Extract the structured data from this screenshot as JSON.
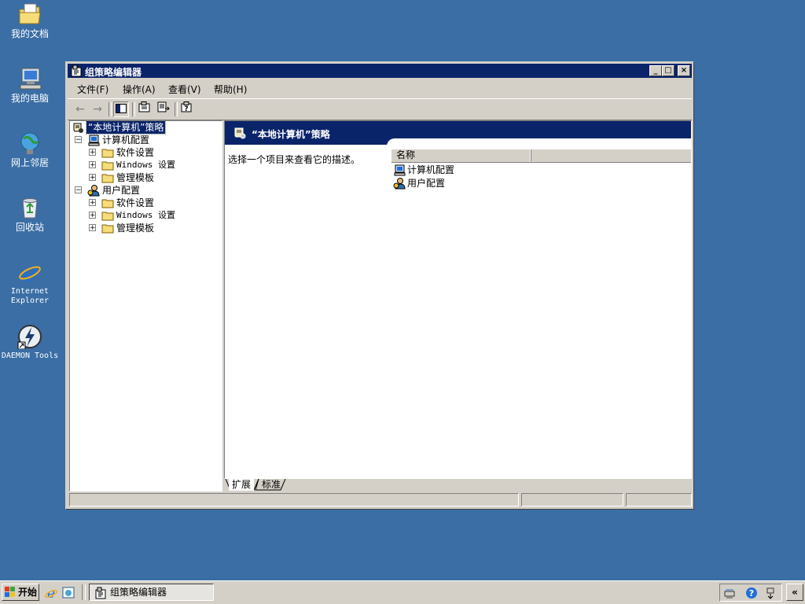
{
  "desktop": {
    "icons": [
      {
        "label": "我的文档",
        "icon": "my-documents-icon"
      },
      {
        "label": "我的电脑",
        "icon": "my-computer-icon"
      },
      {
        "label": "网上邻居",
        "icon": "network-places-icon"
      },
      {
        "label": "回收站",
        "icon": "recycle-bin-icon"
      },
      {
        "label": "Internet\nExplorer",
        "icon": "internet-explorer-icon"
      },
      {
        "label": "DAEMON Tools",
        "icon": "daemon-tools-icon"
      }
    ]
  },
  "window": {
    "title": "组策略编辑器",
    "controls": {
      "minimize": "_",
      "maximize": "□",
      "close": "×"
    },
    "menu": [
      "文件(F)",
      "操作(A)",
      "查看(V)",
      "帮助(H)"
    ],
    "toolbar_icons": [
      "back-arrow-icon",
      "forward-arrow-icon",
      "show-hide-tree-icon",
      "properties-icon",
      "export-list-icon",
      "help-icon"
    ],
    "tree": {
      "root": "“本地计算机”策略",
      "computer_config": "计算机配置",
      "computer_children": [
        "软件设置",
        "Windows 设置",
        "管理模板"
      ],
      "user_config": "用户配置",
      "user_children": [
        "软件设置",
        "Windows 设置",
        "管理模板"
      ],
      "expand_minus": "−",
      "expand_plus": "+"
    },
    "right_pane": {
      "header": "“本地计算机”策略",
      "description": "选择一个项目来查看它的描述。",
      "column_name": "名称",
      "items": [
        "计算机配置",
        "用户配置"
      ]
    },
    "tabs": [
      "扩展",
      "标准"
    ],
    "active_tab": "扩展"
  },
  "taskbar": {
    "start_label": "开始",
    "task_label": "组策略编辑器",
    "chevron": "«",
    "tray_icons": [
      "network-icon",
      "help-icon",
      "safely-remove-icon"
    ]
  },
  "colors": {
    "desktop": "#3a6ea5",
    "title_bar": "#0a246a",
    "face": "#d4d0c8"
  }
}
